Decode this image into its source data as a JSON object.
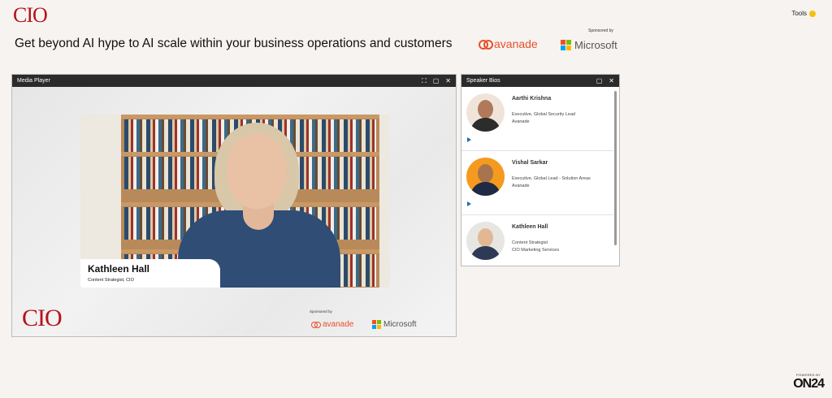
{
  "header": {
    "logo": "CIO",
    "tools_label": "Tools",
    "title": "Get beyond AI hype to AI scale within your business operations and customers",
    "sponsored_label": "Sponsored by",
    "sponsors": [
      "avanade",
      "Microsoft"
    ]
  },
  "media_player": {
    "title": "Media Player",
    "speaker_name": "Kathleen Hall",
    "speaker_title": "Content Strategist, CIO",
    "logo": "CIO",
    "sponsored_label": "Sponsored by",
    "sponsors": [
      "avanade",
      "Microsoft"
    ]
  },
  "speaker_bios": {
    "title": "Speaker Bios",
    "speakers": [
      {
        "name": "Aarthi Krishna",
        "title_line1": "Executive, Global Security Lead",
        "title_line2": "Avanade",
        "avatar_bg": "#f0e4da"
      },
      {
        "name": "Vishal Sarkar",
        "title_line1": "Executive, Global Lead - Solution Areas",
        "title_line2": "Avanade",
        "avatar_bg": "#f59a1e"
      },
      {
        "name": "Kathleen Hall",
        "title_line1": "Content Strategist",
        "title_line2": "CIO Marketing Services",
        "avatar_bg": "#e8e6e3"
      }
    ]
  },
  "footer": {
    "powered_by": "POWERED BY",
    "brand": "ON24"
  },
  "colors": {
    "cio_red": "#b5121b",
    "avanade_orange": "#e8502a",
    "panel_header": "#2b2b2b",
    "ms_red": "#f25022",
    "ms_green": "#7fba00",
    "ms_blue": "#00a4ef",
    "ms_yellow": "#ffb900"
  }
}
